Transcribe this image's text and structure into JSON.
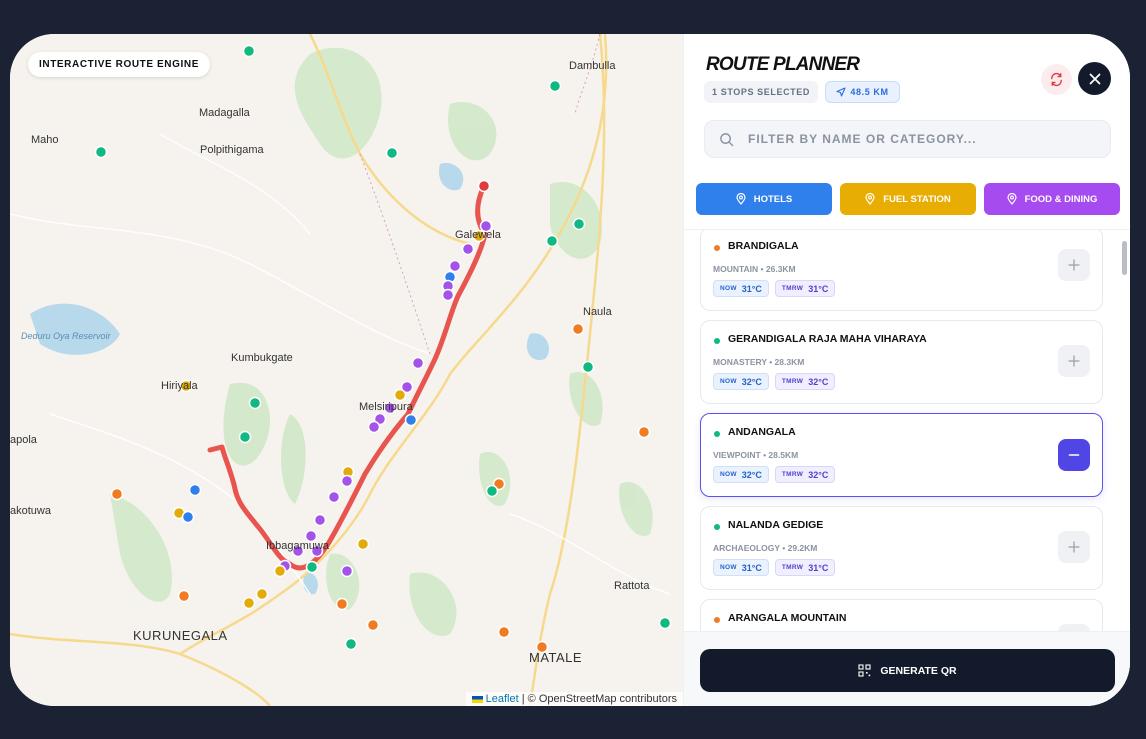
{
  "map": {
    "badge": "INTERACTIVE ROUTE ENGINE",
    "labels": {
      "dambulla": "Dambulla",
      "maho": "Maho",
      "madagalla": "Madagalla",
      "polpithigama": "Polpithigama",
      "galewela": "Galewela",
      "naula": "Naula",
      "deduru": "Deduru Oya Reservoir",
      "kumbukgate": "Kumbukgate",
      "hiriyala": "Hiriyala",
      "melsiripura": "Melsiripura",
      "polpola": "apola",
      "makotuwa": "akotuwa",
      "ibbagamuwa": "Ibbagamuwa",
      "rattota": "Rattota",
      "kurunegala": "KURUNEGALA",
      "matale": "MATALE"
    },
    "attribution": {
      "leaflet": "Leaflet",
      "separator": " | © ",
      "osm": "OpenStreetMap contributors"
    },
    "colors": {
      "route": "#e8544e",
      "hotels": "#2f80ed",
      "fuel": "#e3ab0a",
      "food": "#a453ea",
      "mountain": "#f07b22",
      "green": "#10b981"
    }
  },
  "panel": {
    "title": "ROUTE PLANNER",
    "stops_selected": "1 STOPS SELECTED",
    "distance": "48.5 KM",
    "refresh_icon": "refresh-icon",
    "close_icon": "close-icon",
    "search_placeholder": "FILTER BY NAME OR CATEGORY...",
    "categories": [
      {
        "label": "HOTELS",
        "color": "#2f80ed"
      },
      {
        "label": "FUEL STATION",
        "color": "#e8ad03"
      },
      {
        "label": "FOOD & DINING",
        "color": "#a64bef"
      }
    ],
    "places": [
      {
        "name": "BRANDIGALA",
        "type": "MOUNTAIN",
        "dist": "26.3KM",
        "now_label": "NOW",
        "now": "31°C",
        "tmrw_label": "TMRW",
        "tmrw": "31°C",
        "dot": "#f07b22",
        "selected": false
      },
      {
        "name": "GERANDIGALA RAJA MAHA VIHARAYA",
        "type": "MONASTERY",
        "dist": "28.3KM",
        "now_label": "NOW",
        "now": "32°C",
        "tmrw_label": "TMRW",
        "tmrw": "32°C",
        "dot": "#10b981",
        "selected": false
      },
      {
        "name": "ANDANGALA",
        "type": "VIEWPOINT",
        "dist": "28.5KM",
        "now_label": "NOW",
        "now": "32°C",
        "tmrw_label": "TMRW",
        "tmrw": "32°C",
        "dot": "#10b981",
        "selected": true
      },
      {
        "name": "NALANDA GEDIGE",
        "type": "ARCHAEOLOGY",
        "dist": "29.2KM",
        "now_label": "NOW",
        "now": "31°C",
        "tmrw_label": "TMRW",
        "tmrw": "31°C",
        "dot": "#10b981",
        "selected": false
      },
      {
        "name": "ARANGALA MOUNTAIN",
        "type": "",
        "dist": "",
        "now_label": "",
        "now": "",
        "tmrw_label": "",
        "tmrw": "",
        "dot": "#f07b22",
        "selected": false
      }
    ],
    "meta_separator": " • ",
    "generate_label": "GENERATE QR"
  }
}
